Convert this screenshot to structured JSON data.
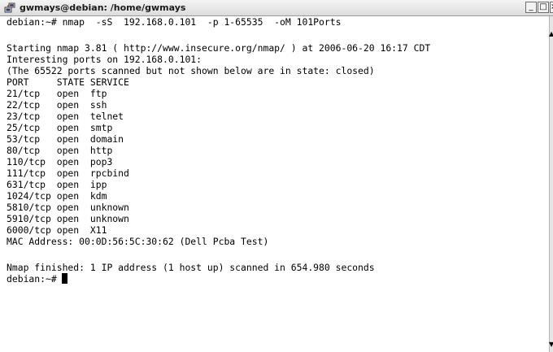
{
  "window": {
    "title": "gwmays@debian: /home/gwmays",
    "icon": "putty-terminal-icon",
    "buttons": {
      "minimize": "_",
      "maximize": "□",
      "close": "×"
    }
  },
  "terminal": {
    "lines": [
      "debian:~# nmap  -sS  192.168.0.101  -p 1-65535  -oM 101Ports",
      "",
      "Starting nmap 3.81 ( http://www.insecure.org/nmap/ ) at 2006-06-20 16:17 CDT",
      "Interesting ports on 192.168.0.101:",
      "(The 65522 ports scanned but not shown below are in state: closed)",
      "PORT     STATE SERVICE",
      "21/tcp   open  ftp",
      "22/tcp   open  ssh",
      "23/tcp   open  telnet",
      "25/tcp   open  smtp",
      "53/tcp   open  domain",
      "80/tcp   open  http",
      "110/tcp  open  pop3",
      "111/tcp  open  rpcbind",
      "631/tcp  open  ipp",
      "1024/tcp open  kdm",
      "5810/tcp open  unknown",
      "5910/tcp open  unknown",
      "6000/tcp open  X11",
      "MAC Address: 00:0D:56:5C:30:62 (Dell Pcba Test)",
      "",
      "Nmap finished: 1 IP address (1 host up) scanned in 654.980 seconds",
      "debian:~#"
    ]
  },
  "colors": {
    "background": "#ffffff",
    "text": "#000000",
    "titlebar": "#e6e6e6"
  }
}
